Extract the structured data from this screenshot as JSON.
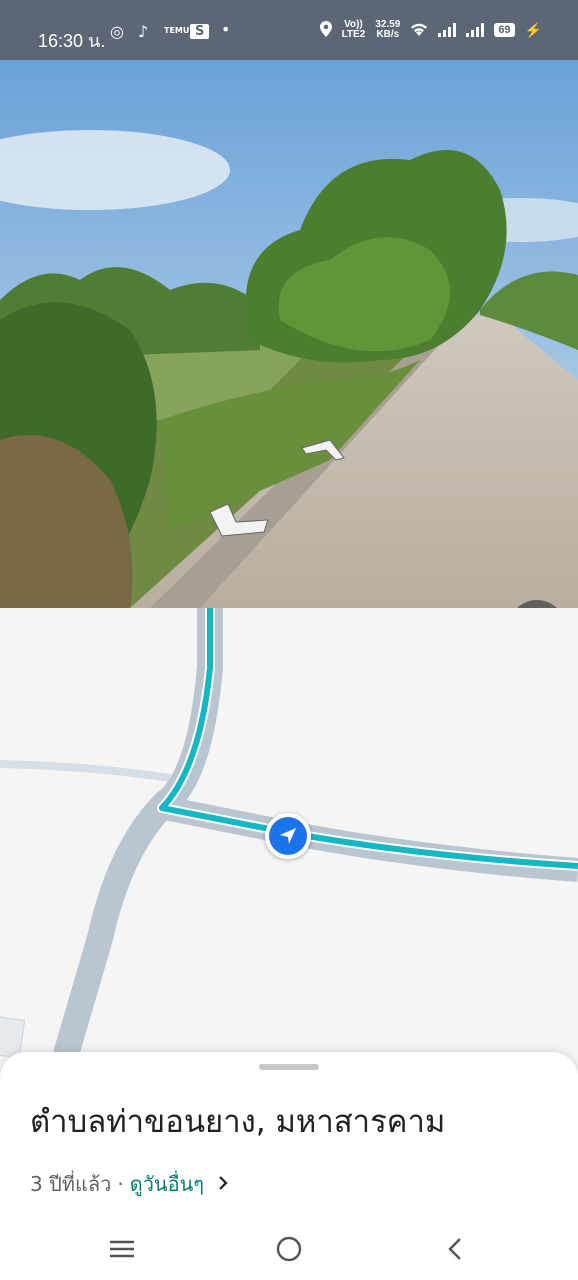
{
  "status_bar": {
    "time": "16:30 น.",
    "volte_label": "Vo))\nLTE2",
    "network_speed": "32.59\nKB/s",
    "battery": "69"
  },
  "street_view": {
    "expand_icon": "expand-diagonal-icon"
  },
  "map": {
    "route_color": "#14b8c4",
    "road_color": "#b9c5d0",
    "location_marker_icon": "navigation-arrow-icon",
    "marker_color": "#1a73e8"
  },
  "place": {
    "title": "ตำบลท่าขอนยาง, มหาสารคาม",
    "age": "3 ปีที่แล้ว",
    "separator": "·",
    "see_more": "ดูวันอื่นๆ",
    "chevron": "›"
  },
  "nav": {
    "recents_icon": "menu-lines-icon",
    "home_icon": "circle-home-icon",
    "back_icon": "back-chevron-icon"
  }
}
